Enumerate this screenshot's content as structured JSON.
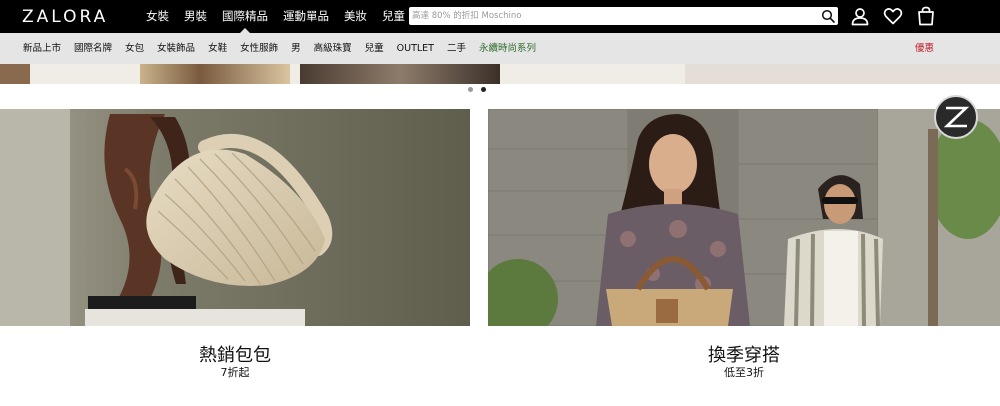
{
  "header": {
    "logo": "ZALORA",
    "nav": [
      {
        "label": "女裝",
        "active": false
      },
      {
        "label": "男裝",
        "active": false
      },
      {
        "label": "國際精品",
        "active": true
      },
      {
        "label": "運動單品",
        "active": false
      },
      {
        "label": "美妝",
        "active": false
      },
      {
        "label": "兒童",
        "active": false
      }
    ],
    "search": {
      "placeholder": "高達 80% 的折扣 Moschino",
      "icon": "search-icon"
    },
    "icons": [
      "account-icon",
      "wishlist-heart-icon",
      "shopping-bag-icon"
    ]
  },
  "subnav": {
    "items": [
      {
        "label": "新品上市",
        "highlight": false
      },
      {
        "label": "國際名牌",
        "highlight": false
      },
      {
        "label": "女包",
        "highlight": false
      },
      {
        "label": "女裝飾品",
        "highlight": false
      },
      {
        "label": "女鞋",
        "highlight": false
      },
      {
        "label": "女性服飾",
        "highlight": false
      },
      {
        "label": "男",
        "highlight": false
      },
      {
        "label": "高級珠寶",
        "highlight": false
      },
      {
        "label": "兒童",
        "highlight": false
      },
      {
        "label": "OUTLET",
        "highlight": false
      },
      {
        "label": "二手",
        "highlight": false
      },
      {
        "label": "永續時尚系列",
        "highlight": true
      }
    ],
    "sale": "優惠"
  },
  "carousel": {
    "slides": 2,
    "active_index": 1
  },
  "tiles": [
    {
      "title": "熱銷包包",
      "subtitle": "7折起"
    },
    {
      "title": "換季穿搭",
      "subtitle": "低至3折"
    }
  ],
  "chat_button": {
    "label": "Z"
  },
  "colors": {
    "header_bg": "#000000",
    "subnav_bg": "#e5e5e5",
    "sale": "#c0202a",
    "sustainable": "#2e6b2e"
  }
}
